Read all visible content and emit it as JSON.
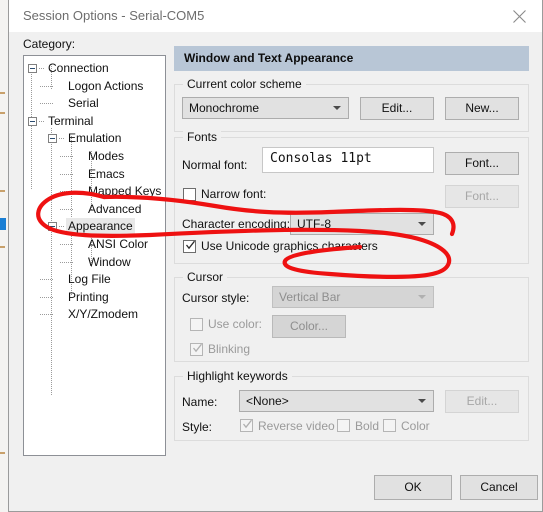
{
  "window": {
    "title": "Session Options - Serial-COM5",
    "close_icon": "close-icon",
    "category_label": "Category:"
  },
  "tree": {
    "items": [
      {
        "label": "Connection",
        "depth": 0,
        "expandable": true,
        "selected": false
      },
      {
        "label": "Logon Actions",
        "depth": 1,
        "expandable": false,
        "selected": false
      },
      {
        "label": "Serial",
        "depth": 1,
        "expandable": false,
        "selected": false
      },
      {
        "label": "Terminal",
        "depth": 0,
        "expandable": true,
        "selected": false
      },
      {
        "label": "Emulation",
        "depth": 1,
        "expandable": true,
        "selected": false
      },
      {
        "label": "Modes",
        "depth": 2,
        "expandable": false,
        "selected": false
      },
      {
        "label": "Emacs",
        "depth": 2,
        "expandable": false,
        "selected": false
      },
      {
        "label": "Mapped Keys",
        "depth": 2,
        "expandable": false,
        "selected": false
      },
      {
        "label": "Advanced",
        "depth": 2,
        "expandable": false,
        "selected": false
      },
      {
        "label": "Appearance",
        "depth": 1,
        "expandable": true,
        "selected": true
      },
      {
        "label": "ANSI Color",
        "depth": 2,
        "expandable": false,
        "selected": false
      },
      {
        "label": "Window",
        "depth": 2,
        "expandable": false,
        "selected": false
      },
      {
        "label": "Log File",
        "depth": 1,
        "expandable": false,
        "selected": false
      },
      {
        "label": "Printing",
        "depth": 1,
        "expandable": false,
        "selected": false
      },
      {
        "label": "X/Y/Zmodem",
        "depth": 1,
        "expandable": false,
        "selected": false
      }
    ]
  },
  "panel": {
    "header": "Window and Text Appearance",
    "color_scheme": {
      "group_label": "Current color scheme",
      "value": "Monochrome",
      "edit_label": "Edit...",
      "new_label": "New..."
    },
    "fonts": {
      "group_label": "Fonts",
      "normal_font_label": "Normal font:",
      "normal_font_value": "Consolas 11pt",
      "normal_font_button": "Font...",
      "narrow_font_label": "Narrow font:",
      "narrow_font_checked": false,
      "narrow_font_button": "Font...",
      "encoding_label": "Character encoding:",
      "encoding_value": "UTF-8",
      "unicode_graphics_label": "Use Unicode graphics characters",
      "unicode_graphics_checked": true
    },
    "cursor": {
      "group_label": "Cursor",
      "style_label": "Cursor style:",
      "style_value": "Vertical Bar",
      "use_color_label": "Use color:",
      "use_color_checked": false,
      "color_button": "Color...",
      "blinking_label": "Blinking",
      "blinking_checked": true
    },
    "highlight": {
      "group_label": "Highlight keywords",
      "name_label": "Name:",
      "name_value": "<None>",
      "edit_label": "Edit...",
      "style_label": "Style:",
      "reverse_video_label": "Reverse video",
      "reverse_video_checked": true,
      "bold_label": "Bold",
      "bold_checked": false,
      "color_label": "Color",
      "color_checked": false
    }
  },
  "footer": {
    "ok_label": "OK",
    "cancel_label": "Cancel"
  },
  "annotation": {
    "color": "#ee1111",
    "description": "hand-drawn-red-loop-around-appearance-and-character-encoding"
  }
}
